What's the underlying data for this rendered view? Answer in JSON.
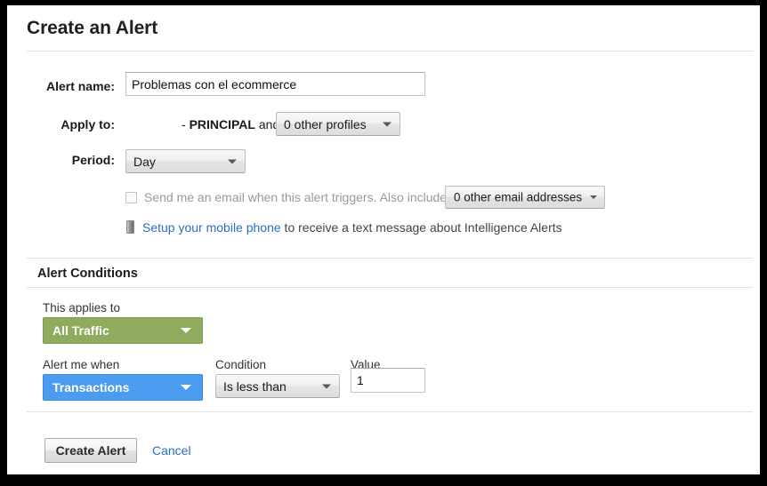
{
  "dialog": {
    "title": "Create an Alert"
  },
  "form": {
    "alert_name": {
      "label": "Alert name:",
      "value": "Problemas con el ecommerce",
      "placeholder": ""
    },
    "apply_to": {
      "label": "Apply to:",
      "prefix": "- ",
      "profile_name": "PRINCIPAL",
      "conjunction": " and ",
      "other_profiles_value": "0 other profiles"
    },
    "period": {
      "label": "Period:",
      "value": "Day"
    },
    "email_notify": {
      "checked": false,
      "text": "Send me an email when this alert triggers. Also include",
      "other_emails_value": "0 other email addresses"
    },
    "mobile_notify": {
      "icon": "mobile-phone-icon",
      "link_text": "Setup your mobile phone",
      "rest_text": " to receive a text message about Intelligence Alerts"
    }
  },
  "alert_conditions": {
    "section_title": "Alert Conditions",
    "applies_to": {
      "label": "This applies to",
      "value": "All Traffic",
      "color": "#8fab5e"
    },
    "alert_me_when": {
      "label": "Alert me when",
      "value": "Transactions",
      "color": "#4b9bf0"
    },
    "condition": {
      "label": "Condition",
      "value": "Is less than"
    },
    "value_field": {
      "label": "Value",
      "value": "1",
      "placeholder": ""
    }
  },
  "actions": {
    "create_label": "Create Alert",
    "cancel_label": "Cancel"
  },
  "icons": {
    "caret_down": "chevron-down-icon"
  }
}
